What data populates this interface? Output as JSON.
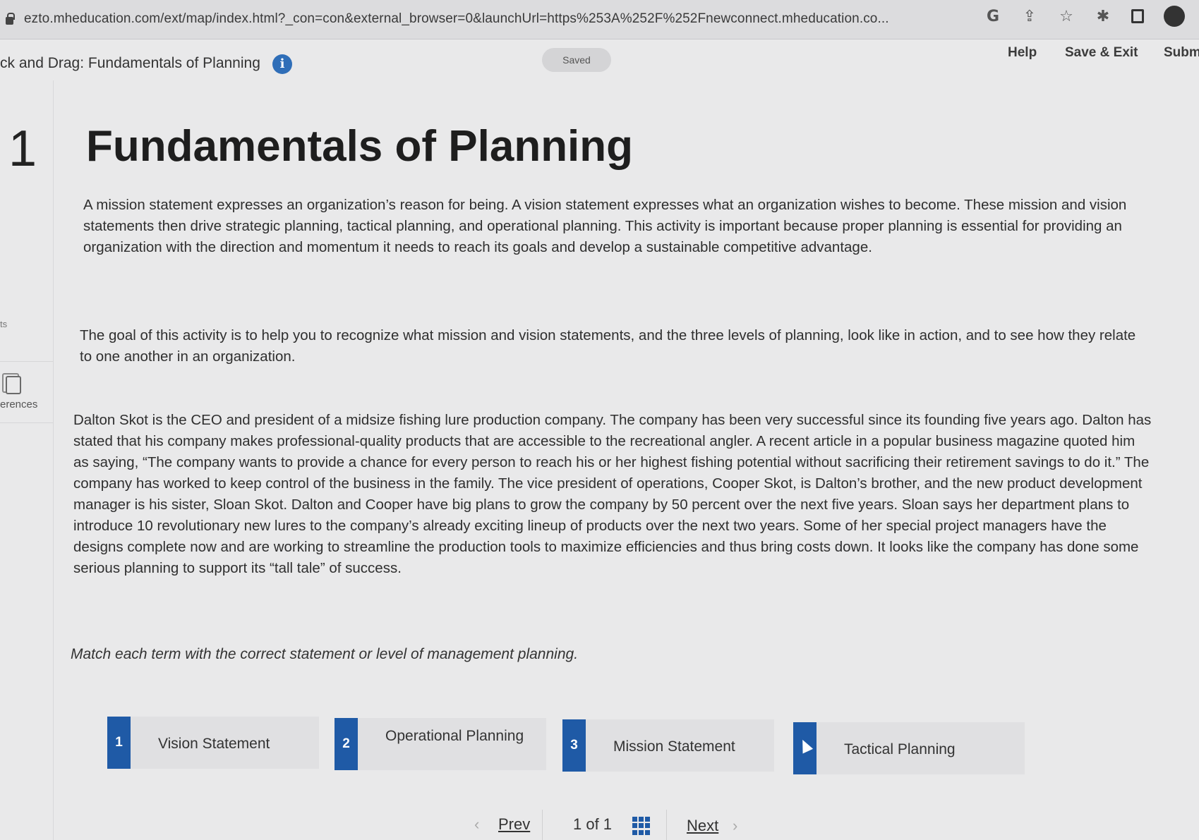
{
  "browser": {
    "url": "ezto.mheducation.com/ext/map/index.html?_con=con&external_browser=0&launchUrl=https%253A%252F%252Fnewconnect.mheducation.co..."
  },
  "header": {
    "title": "ck and Drag: Fundamentals of Planning",
    "saved_label": "Saved",
    "help_label": "Help",
    "save_exit_label": "Save & Exit",
    "submit_label": "Subm"
  },
  "left_rail": {
    "partial_label": "ts",
    "references_label": "erences"
  },
  "question": {
    "number": "1",
    "title": "Fundamentals of Planning",
    "paragraphs": [
      "A mission statement expresses an organization’s reason for being. A vision statement expresses what an organization wishes to become. These mission and vision statements then drive strategic planning, tactical planning, and operational planning. This activity is important because proper planning is essential for providing an organization with the direction and momentum it needs to reach its goals and develop a sustainable competitive advantage.",
      "The goal of this activity is to help you to recognize what mission and vision statements, and the three levels of planning, look like in action, and to see how they relate to one another in an organization.",
      "Dalton Skot is the CEO and president of a midsize fishing lure production company. The company has been very successful since its founding five years ago. Dalton has stated that his company makes professional-quality products that are accessible to the recreational angler. A recent article in a popular business magazine quoted him as saying, “The company wants to provide a chance for every person to reach his or her highest fishing potential without sacrificing their retirement savings to do it.” The company has worked to keep control of the business in the family. The vice president of operations, Cooper Skot, is Dalton’s brother, and the new product development manager is his sister, Sloan Skot. Dalton and Cooper have big plans to grow the company by 50 percent over the next five years. Sloan says her department plans to introduce 10 revolutionary new lures to the company’s already exciting lineup of products over the next two years. Some of her special project managers have the designs complete now and are working to streamline the production tools to maximize efficiencies and thus bring costs down. It looks like the company has done some serious planning to support its “tall tale” of success."
    ],
    "instruction": "Match each term with the correct statement or level of management planning."
  },
  "match_items": [
    {
      "badge": "1",
      "label": "Vision Statement"
    },
    {
      "badge": "2",
      "label": "Operational Planning"
    },
    {
      "badge": "3",
      "label": "Mission Statement"
    },
    {
      "badge": "",
      "label": "Tactical Planning"
    }
  ],
  "pager": {
    "prev_label": "Prev",
    "page_info": "1 of 1",
    "next_label": "Next"
  },
  "colors": {
    "accent": "#1f5aa6",
    "info": "#2f6eb8",
    "background": "#e9e9ea"
  }
}
